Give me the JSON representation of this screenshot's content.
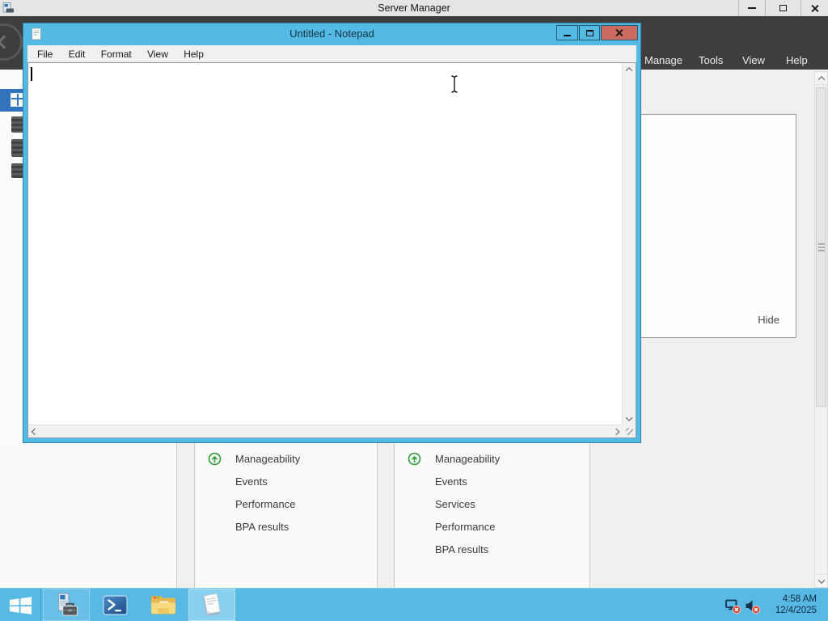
{
  "server_manager": {
    "window_title": "Server Manager",
    "menu": [
      "Manage",
      "Tools",
      "View",
      "Help"
    ],
    "hide_label": "Hide",
    "dashboard_tiles": [
      {
        "items": [
          "Manageability",
          "Events",
          "Performance",
          "BPA results"
        ]
      },
      {
        "items": [
          "Manageability",
          "Events",
          "Services",
          "Performance",
          "BPA results"
        ]
      }
    ]
  },
  "notepad": {
    "window_title": "Untitled - Notepad",
    "menu": [
      "File",
      "Edit",
      "Format",
      "View",
      "Help"
    ],
    "text_content": ""
  },
  "taskbar": {
    "clock_time": "4:58 AM",
    "clock_date": "12/4/2025"
  },
  "colors": {
    "taskbar_blue": "#57B9E4",
    "notepad_chrome": "#52BAE4",
    "close_button_red": "#CE6B5F",
    "navbar_dark": "#3E3E3E",
    "sidebar_selected_blue": "#3273BD",
    "status_green": "#2F9E38",
    "content_background": "#F1F0EE"
  },
  "icons": {
    "server-manager-app": "server-with-flag",
    "back": "left-chevron-in-circle",
    "dashboard": "window-grid",
    "sidebar-server": "server-glyph",
    "status-up": "green-circle-up-arrow",
    "notepad-app": "notepad-page",
    "minimize": "–",
    "restore": "❐",
    "maximize": "□",
    "close": "✕",
    "scroll-up": "∧",
    "scroll-down": "∨",
    "scroll-left": "<",
    "scroll-right": ">",
    "windows-start": "windows-flag",
    "powershell": ">_",
    "file-explorer": "folder",
    "network-status": "display-with-error-badge",
    "volume-status": "speaker-with-error-badge",
    "text-cursor": "caret",
    "mouse-ibeam": "i-beam"
  }
}
